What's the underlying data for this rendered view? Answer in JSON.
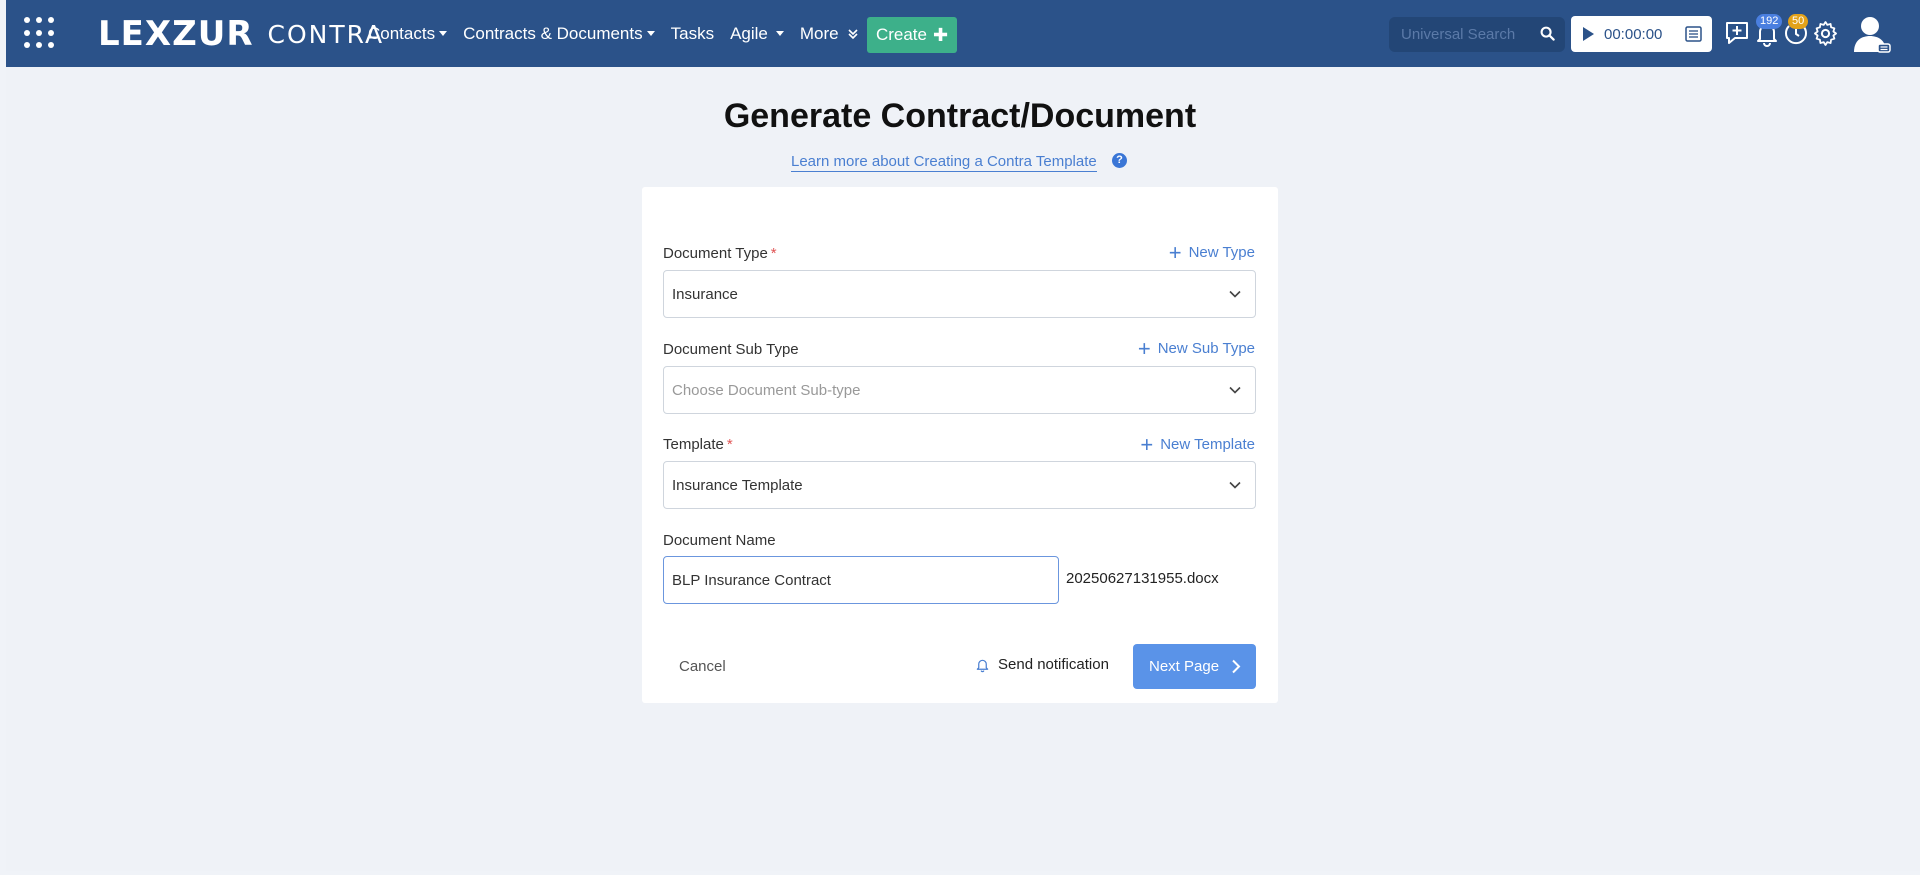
{
  "navbar": {
    "logo_primary": "LEXZUR",
    "logo_secondary": "CONTRA",
    "links": [
      {
        "label": "Contacts"
      },
      {
        "label": "Contracts & Documents"
      },
      {
        "label": "Tasks"
      },
      {
        "label": "Agile"
      },
      {
        "label": "More"
      }
    ],
    "create_label": "Create",
    "search_placeholder": "Universal Search",
    "timer_value": "00:00:00",
    "notifications_badge": "192",
    "reminders_badge": "50",
    "brand_color": "#2b5289",
    "create_color": "#3db08a"
  },
  "page": {
    "title": "Generate Contract/Document",
    "learn_more": "Learn more about Creating a Contra Template",
    "help_icon": "?"
  },
  "form": {
    "document_type": {
      "label": "Document Type",
      "required_mark": "*",
      "add_label": "New Type",
      "value": "Insurance"
    },
    "document_sub_type": {
      "label": "Document Sub Type",
      "add_label": "New Sub Type",
      "placeholder": "Choose Document Sub-type"
    },
    "template": {
      "label": "Template",
      "required_mark": "*",
      "add_label": "New Template",
      "value": "Insurance Template"
    },
    "document_name": {
      "label": "Document Name",
      "value": "BLP Insurance Contract",
      "suffix": "20250627131955.docx"
    },
    "actions": {
      "cancel": "Cancel",
      "send_notification": "Send notification",
      "next": "Next Page"
    },
    "primary_button_color": "#5a93e8"
  }
}
